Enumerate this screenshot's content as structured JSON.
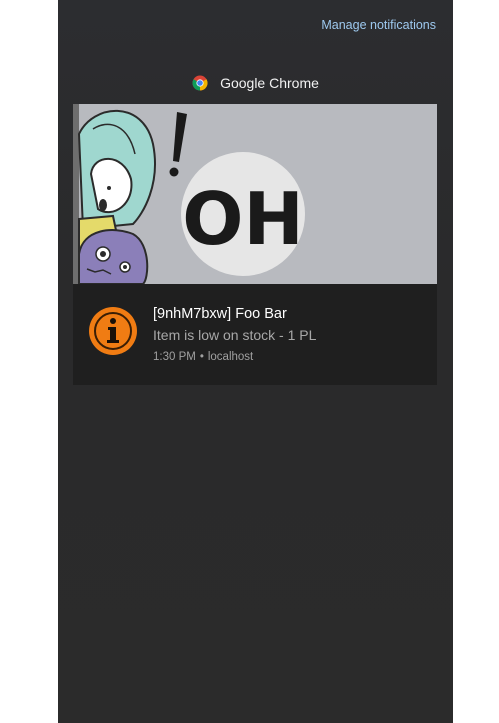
{
  "action_center": {
    "manage_label": "Manage notifications",
    "app_header": {
      "icon": "chrome-icon",
      "name": "Google Chrome"
    },
    "notification": {
      "hero_image": {
        "text": "OH",
        "description_icon": "comic-hero-image"
      },
      "icon": "info-icon",
      "icon_color": "#f07c13",
      "title": "[9nhM7bxw] Foo Bar",
      "message": "Item is low on stock - 1 PL",
      "time": "1:30 PM",
      "separator": "•",
      "source": "localhost"
    }
  }
}
